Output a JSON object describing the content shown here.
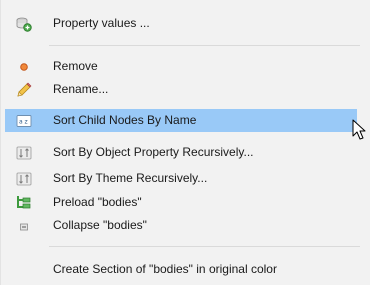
{
  "menu": {
    "items": [
      {
        "label": "Property values ...",
        "icon": "property-values-icon"
      },
      {
        "label": "Remove",
        "icon": "remove-icon"
      },
      {
        "label": "Rename...",
        "icon": "pencil-icon"
      },
      {
        "label": "Sort Child Nodes By Name",
        "icon": "sort-az-icon",
        "selected": true
      },
      {
        "label": "Sort By Object Property Recursively...",
        "icon": "sort-recursive-icon"
      },
      {
        "label": "Sort By Theme Recursively...",
        "icon": "sort-recursive-icon"
      },
      {
        "label": "Preload \"bodies\"",
        "icon": "preload-icon"
      },
      {
        "label": "Collapse \"bodies\"",
        "icon": "collapse-icon"
      },
      {
        "label": "Create Section of \"bodies\" in original color",
        "icon": ""
      }
    ]
  },
  "colors": {
    "menu_background": "#f2f2f2",
    "selected_background": "#99c9f7",
    "separator": "#dadada"
  }
}
